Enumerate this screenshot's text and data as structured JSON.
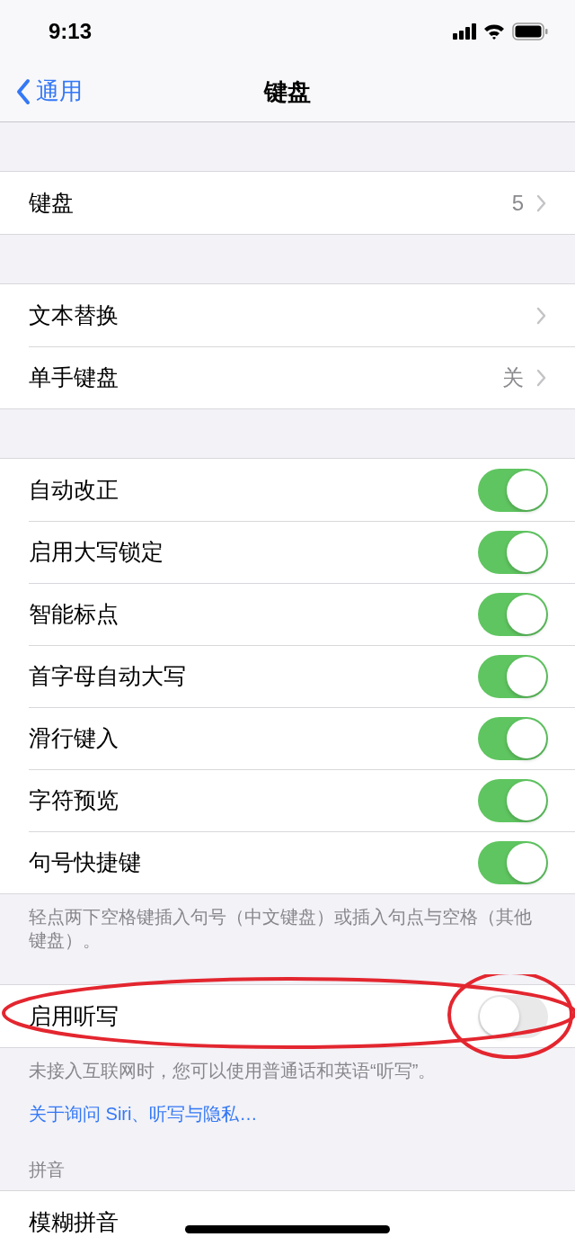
{
  "status_bar": {
    "time": "9:13"
  },
  "nav": {
    "back": "通用",
    "title": "键盘"
  },
  "sections": [
    {
      "rows": [
        {
          "kind": "nav",
          "label": "键盘",
          "value": "5"
        }
      ]
    },
    {
      "rows": [
        {
          "kind": "nav",
          "label": "文本替换"
        },
        {
          "kind": "nav",
          "label": "单手键盘",
          "value": "关"
        }
      ]
    },
    {
      "rows": [
        {
          "kind": "toggle",
          "label": "自动改正",
          "on": true
        },
        {
          "kind": "toggle",
          "label": "启用大写锁定",
          "on": true
        },
        {
          "kind": "toggle",
          "label": "智能标点",
          "on": true
        },
        {
          "kind": "toggle",
          "label": "首字母自动大写",
          "on": true
        },
        {
          "kind": "toggle",
          "label": "滑行键入",
          "on": true
        },
        {
          "kind": "toggle",
          "label": "字符预览",
          "on": true
        },
        {
          "kind": "toggle",
          "label": "句号快捷键",
          "on": true
        }
      ],
      "footer": "轻点两下空格键插入句号（中文键盘）或插入句点与空格（其他键盘）。"
    },
    {
      "rows": [
        {
          "kind": "toggle",
          "label": "启用听写",
          "on": false,
          "circled": true,
          "toggle_circled": true
        }
      ],
      "footer": "未接入互联网时，您可以使用普通话和英语“听写”。",
      "link": "关于询问 Siri、听写与隐私…"
    },
    {
      "header": "拼音",
      "rows": [
        {
          "kind": "plain",
          "label": "模糊拼音"
        }
      ]
    }
  ]
}
